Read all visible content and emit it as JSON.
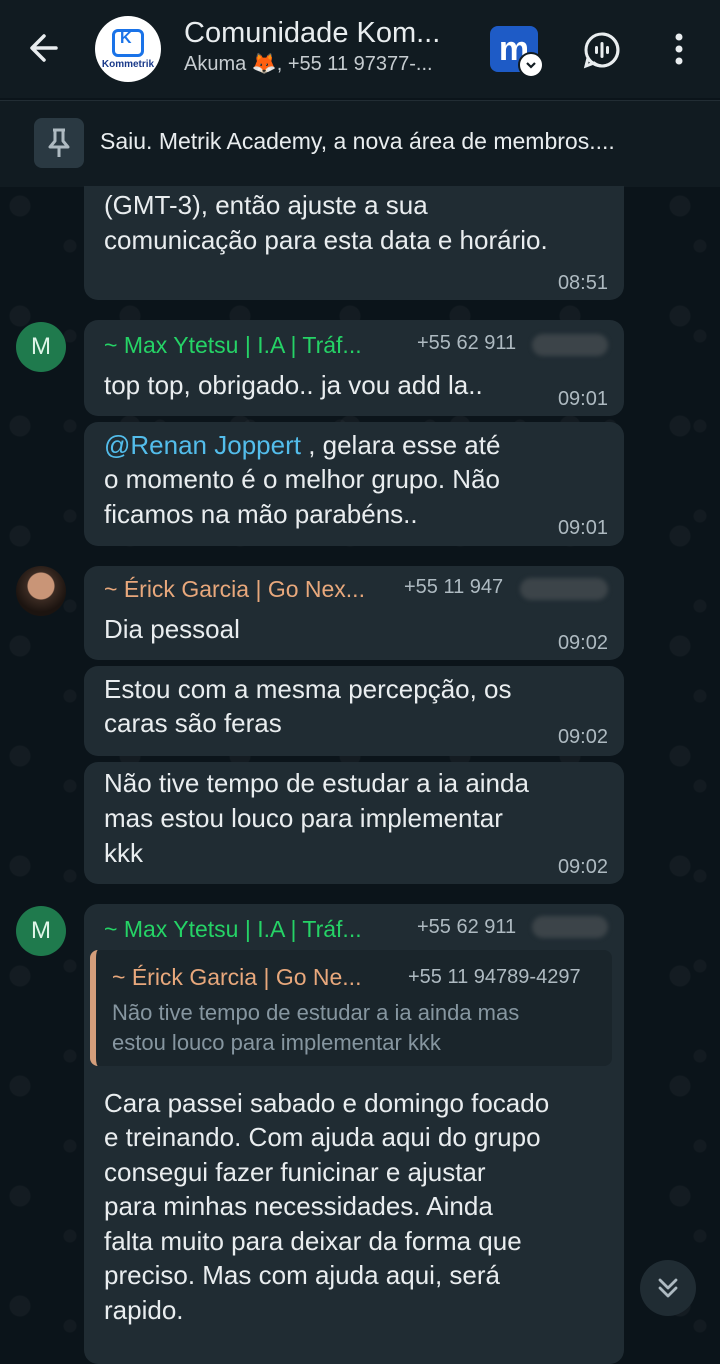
{
  "header": {
    "title": "Comunidade Kom...",
    "subtitle": "Akuma 🦊, +55 11 97377-...",
    "avatar_text": "Kommetrik",
    "app_badge_letter": "m"
  },
  "pinned": {
    "text": "Saiu. Metrik Academy, a nova área de membros...."
  },
  "messages": {
    "m1": {
      "line1": "(GMT-3), então ajuste a sua",
      "line2": "comunicação para esta data e horário.",
      "time": "08:51"
    },
    "m2": {
      "avatar": "M",
      "sender": "~ Max Ytetsu | I.A | Tráf...",
      "phone": "+55 62 911",
      "text": "top top, obrigado.. ja vou add la..",
      "time": "09:01"
    },
    "m3": {
      "mention": "@Renan Joppert",
      "line1_rest": " , gelara esse até",
      "line2": "o momento é o melhor grupo. Não",
      "line3": "ficamos na mão parabéns..",
      "time": "09:01"
    },
    "m4": {
      "sender": "~ Érick Garcia | Go Nex...",
      "phone": "+55 11 947",
      "text": "Dia pessoal",
      "time": "09:02"
    },
    "m5": {
      "line1": "Estou com a mesma percepção, os",
      "line2": "caras são feras",
      "time": "09:02"
    },
    "m6": {
      "line1": "Não tive tempo de estudar a ia ainda",
      "line2": "mas estou louco para implementar",
      "line3": "kkk",
      "time": "09:02"
    },
    "m7": {
      "avatar": "M",
      "sender": "~ Max Ytetsu | I.A | Tráf...",
      "phone": "+55 62 911",
      "quote_sender": "~ Érick Garcia | Go Ne...",
      "quote_phone": "+55 11 94789-4297",
      "quote_line1": "Não tive tempo de estudar a ia ainda mas",
      "quote_line2": "estou louco para implementar kkk",
      "line1": "Cara passei sabado e domingo focado",
      "line2": "e treinando. Com ajuda aqui do grupo",
      "line3": "consegui fazer funicinar e ajustar",
      "line4": "para minhas necessidades. Ainda",
      "line5": "falta muito para deixar da forma que",
      "line6": "preciso. Mas com ajuda aqui, será",
      "line7": "rapido."
    }
  },
  "colors": {
    "sender_max": "#25d366",
    "sender_erick": "#e8a87c",
    "mention": "#53bdeb",
    "bubble": "#202c33",
    "background": "#0b141a"
  }
}
